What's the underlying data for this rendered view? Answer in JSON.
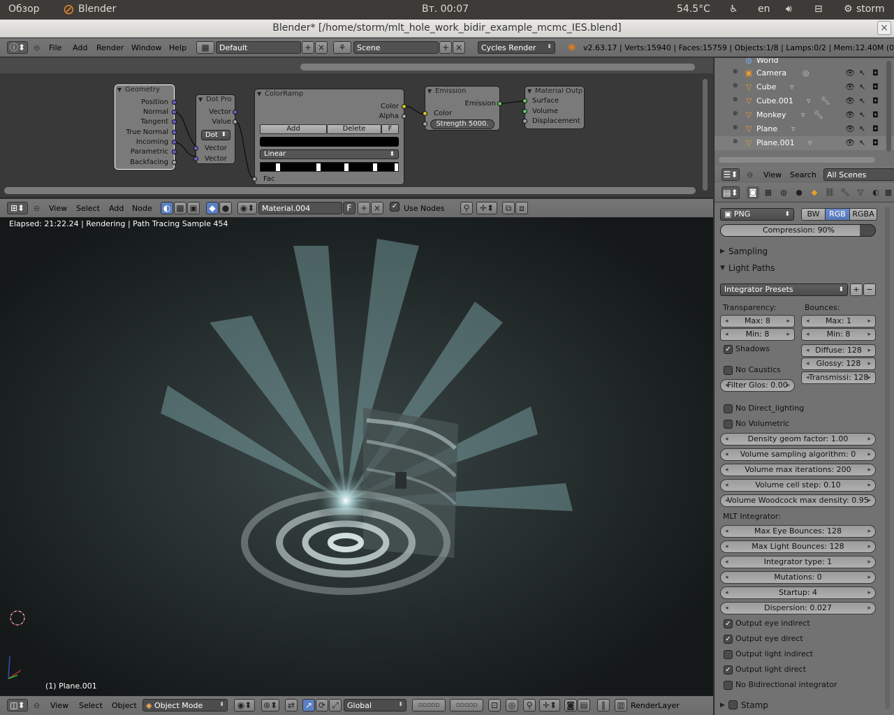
{
  "os_bar": {
    "activities": "Обзор",
    "app_name": "Blender",
    "clock": "Вт. 00:07",
    "temperature": "54.5°C",
    "lang": "en",
    "user": "storm"
  },
  "window": {
    "title": "Blender* [/home/storm/mlt_hole_work_bidir_example_mcmc_IES.blend]",
    "close": "×"
  },
  "info_header": {
    "menu": [
      "File",
      "Add",
      "Render",
      "Window",
      "Help"
    ],
    "screen_layout": "Default",
    "scene": "Scene",
    "render_engine": "Cycles Render",
    "stats": "v2.63.17 | Verts:15940 | Faces:15759 | Objects:1/8 | Lamps:0/2 | Mem:12.40M (0.40M"
  },
  "nodes": {
    "geometry": {
      "title": "Geometry",
      "outputs": [
        "Position",
        "Normal",
        "Tangent",
        "True Normal",
        "Incoming",
        "Parametric",
        "Backfacing"
      ]
    },
    "dot_product": {
      "title": "Dot Pro",
      "outputs": [
        "Vector",
        "Value"
      ],
      "mode": "Dot",
      "inputs": [
        "Vector",
        "Vector"
      ]
    },
    "color_ramp": {
      "title": "ColorRamp",
      "outputs": [
        "Color",
        "Alpha"
      ],
      "add": "Add",
      "delete": "Delete",
      "flip": "F",
      "interpolation": "Linear",
      "input": "Fac"
    },
    "emission": {
      "title": "Emission",
      "output": "Emission",
      "input_color": "Color",
      "strength": "Strength 5000."
    },
    "material_output": {
      "title": "Material Outp",
      "inputs": [
        "Surface",
        "Volume",
        "Displacement"
      ]
    }
  },
  "node_header": {
    "menu": [
      "View",
      "Select",
      "Add",
      "Node"
    ],
    "material": "Material.004",
    "fake_user": "F",
    "use_nodes": "Use Nodes"
  },
  "viewport": {
    "status": "Elapsed: 21:22.24 | Rendering | Path Tracing Sample 454",
    "object_label": "(1) Plane.001"
  },
  "bottom_header": {
    "menu": [
      "View",
      "Select",
      "Object"
    ],
    "mode": "Object Mode",
    "orientation": "Global",
    "render_layer": "RenderLayer"
  },
  "outliner": {
    "items": [
      {
        "label": "World",
        "icon": "world-icon"
      },
      {
        "label": "Camera",
        "icon": "camera-icon"
      },
      {
        "label": "Cube",
        "icon": "mesh-icon"
      },
      {
        "label": "Cube.001",
        "icon": "mesh-icon"
      },
      {
        "label": "Monkey",
        "icon": "mesh-icon"
      },
      {
        "label": "Plane",
        "icon": "mesh-icon"
      },
      {
        "label": "Plane.001",
        "icon": "mesh-icon"
      }
    ],
    "header_menu": [
      "View",
      "Search"
    ],
    "filter": "All Scenes"
  },
  "properties": {
    "file_format": "PNG",
    "color_modes": [
      "BW",
      "RGB",
      "RGBA"
    ],
    "active_color_mode": "RGB",
    "compression": "Compression: 90%",
    "compression_fraction": 0.9,
    "sections": {
      "sampling": "Sampling",
      "light_paths": "Light Paths",
      "stamp": "Stamp"
    },
    "integrator_presets": "Integrator Presets",
    "transparency_label": "Transparency:",
    "bounces_label": "Bounces:",
    "transparency_max": "Max: 8",
    "transparency_min": "Min: 8",
    "bounces_max": "Max: 1",
    "bounces_min": "Min: 8",
    "shadows": "Shadows",
    "no_caustics": "No Caustics",
    "filter_glossy": "Filter Glos: 0.00",
    "diffuse": "Diffuse: 128",
    "glossy": "Glossy: 128",
    "transmission": "Transmissi: 128",
    "no_direct_lighting": "No Direct_lighting",
    "no_volumetric": "No Volumetric",
    "volume_fields": [
      "Density geom factor: 1.00",
      "Volume sampling algorithm: 0",
      "Volume max iterations: 200",
      "Volume cell step: 0.10",
      "Volume Woodcock max density: 0.95"
    ],
    "mlt_label": "MLT Integrator:",
    "mlt_fields": [
      "Max Eye Bounces: 128",
      "Max Light Bounces: 128",
      "Integrator type: 1",
      "Mutations: 0",
      "Startup: 4",
      "Dispersion: 0.027"
    ],
    "checks": [
      {
        "label": "Output eye indirect",
        "checked": true
      },
      {
        "label": "Output eye direct",
        "checked": true
      },
      {
        "label": "Output light indirect",
        "checked": false
      },
      {
        "label": "Output light direct",
        "checked": true
      },
      {
        "label": "No Bidirectional integrator",
        "checked": false
      }
    ]
  }
}
